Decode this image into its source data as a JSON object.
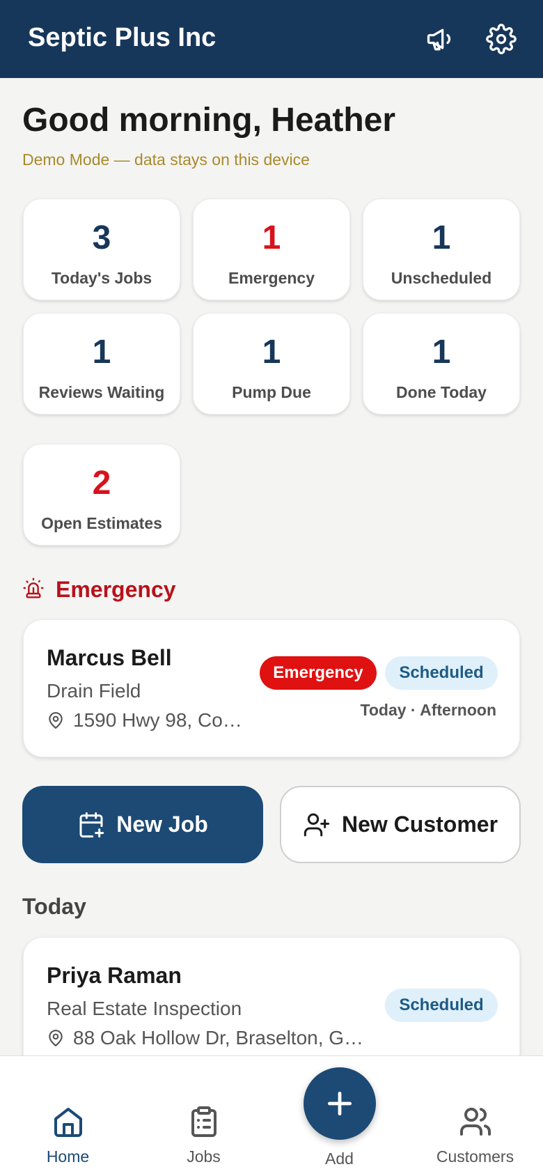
{
  "header": {
    "title": "Septic Plus Inc",
    "announcements_icon": "megaphone-icon",
    "settings_icon": "gear-icon"
  },
  "greeting": "Good morning, Heather",
  "demo_note": "Demo Mode — data stays on this device",
  "stats": [
    {
      "value": "3",
      "label": "Today's Jobs",
      "color": "#17375a"
    },
    {
      "value": "1",
      "label": "Emergency",
      "color": "#d8121c"
    },
    {
      "value": "1",
      "label": "Unscheduled",
      "color": "#17375a"
    },
    {
      "value": "1",
      "label": "Reviews Waiting",
      "color": "#17375a"
    },
    {
      "value": "1",
      "label": "Pump Due",
      "color": "#17375a"
    },
    {
      "value": "1",
      "label": "Done Today",
      "color": "#17375a"
    },
    {
      "value": "2",
      "label": "Open Estimates",
      "color": "#d8121c"
    }
  ],
  "emergency_section": {
    "title": "Emergency",
    "icon": "siren-icon",
    "job": {
      "name": "Marcus Bell",
      "service": "Drain Field",
      "address": "1590 Hwy 98, Co…",
      "badges": [
        "Emergency",
        "Scheduled"
      ],
      "when": "Today · Afternoon"
    }
  },
  "actions": {
    "new_job": "New Job",
    "new_customer": "New Customer"
  },
  "today_section": {
    "title": "Today",
    "job": {
      "name": "Priya Raman",
      "service": "Real Estate Inspection",
      "address": "88 Oak Hollow Dr, Braselton, G…",
      "badge": "Scheduled"
    }
  },
  "nav": {
    "home": "Home",
    "jobs": "Jobs",
    "add": "Add",
    "customers": "Customers",
    "active": "Home"
  },
  "colors": {
    "brand": "#17375a",
    "accent": "#1c4a75",
    "emergency": "#d8121c",
    "demo": "#a88a2b"
  }
}
